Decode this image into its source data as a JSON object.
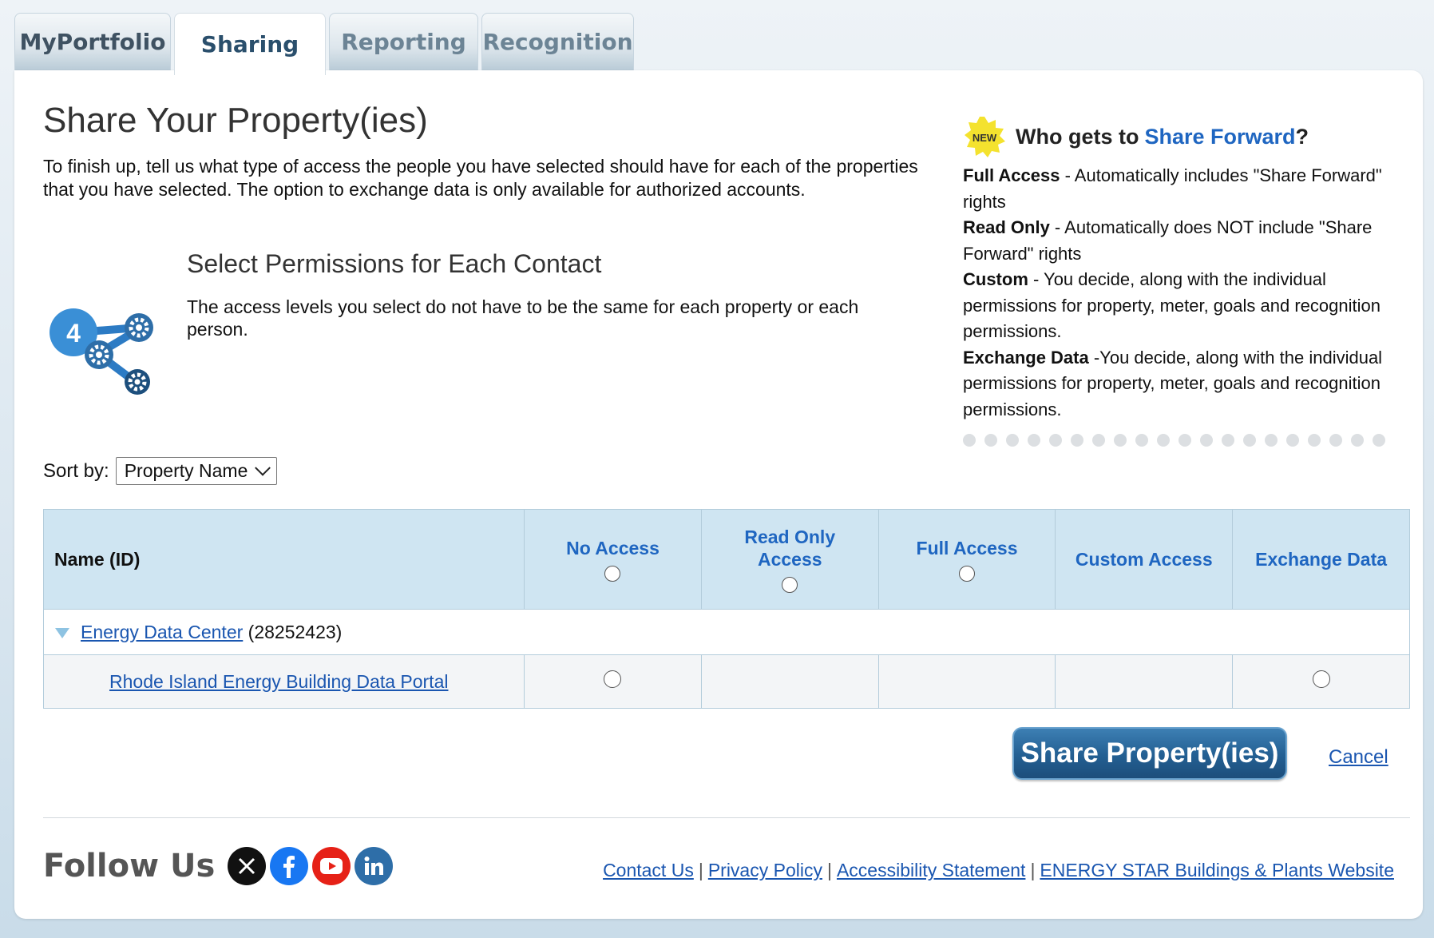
{
  "tabs": [
    {
      "label": "MyPortfolio"
    },
    {
      "label": "Sharing"
    },
    {
      "label": "Reporting"
    },
    {
      "label": "Recognition"
    }
  ],
  "page": {
    "title": "Share Your Property(ies)",
    "intro": "To finish up, tell us what type of access the people you have selected should have for each of the properties that you have selected. The option to exchange data is only available for authorized accounts."
  },
  "step": {
    "number": "4",
    "title": "Select Permissions for Each Contact",
    "description": "The access levels you select do not have to be the same for each property or each person."
  },
  "info": {
    "badge": "NEW",
    "heading_prefix": "Who gets to",
    "heading_link": "Share Forward",
    "heading_suffix": "?",
    "items": [
      {
        "term": "Full Access",
        "text": " - Automatically includes \"Share Forward\" rights"
      },
      {
        "term": "Read Only",
        "text": " - Automatically does NOT include \"Share Forward\" rights"
      },
      {
        "term": "Custom",
        "text": " - You decide, along with the individual permissions for property, meter, goals and recognition permissions."
      },
      {
        "term": "Exchange Data",
        "text": " -You decide, along with the individual permissions for property, meter, goals and recognition permissions."
      }
    ]
  },
  "sort": {
    "label": "Sort by:",
    "selected": "Property Name"
  },
  "table": {
    "headers": {
      "name": "Name (ID)",
      "no_access": "No Access",
      "read_only": "Read Only Access",
      "full_access": "Full Access",
      "custom_access": "Custom Access",
      "exchange_data": "Exchange Data"
    },
    "group": {
      "name": "Energy Data Center",
      "id": "(28252423)"
    },
    "row": {
      "name": "Rhode Island Energy Building Data Portal"
    }
  },
  "actions": {
    "share": "Share Property(ies)",
    "cancel": "Cancel"
  },
  "footer": {
    "follow": "Follow Us",
    "links": [
      "Contact Us",
      "Privacy Policy",
      "Accessibility Statement",
      "ENERGY STAR Buildings & Plants Website"
    ],
    "separator": "|"
  },
  "colors": {
    "accent": "#1f66c1",
    "header_bg": "#cfe5f2",
    "button": "#235f92"
  }
}
